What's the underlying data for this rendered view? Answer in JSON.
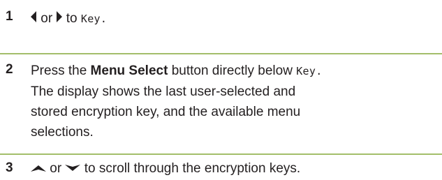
{
  "steps": [
    {
      "number": "1",
      "or": "or",
      "to": "to",
      "key_display": "Key."
    },
    {
      "number": "2",
      "press": "Press the",
      "button_name": "Menu Select",
      "rest1": "button directly below",
      "key_display": "Key.",
      "line2": "The display shows the last user-selected and",
      "line3": "stored encryption key, and the available menu",
      "line4": "selections."
    },
    {
      "number": "3",
      "or": "or",
      "rest": "to scroll through the encryption keys."
    }
  ],
  "icons": {
    "left": "left-arrow-icon",
    "right": "right-arrow-icon",
    "up": "up-arrow-icon",
    "down": "down-arrow-icon"
  },
  "colors": {
    "divider": "#a3be6a",
    "text": "#231f20"
  }
}
